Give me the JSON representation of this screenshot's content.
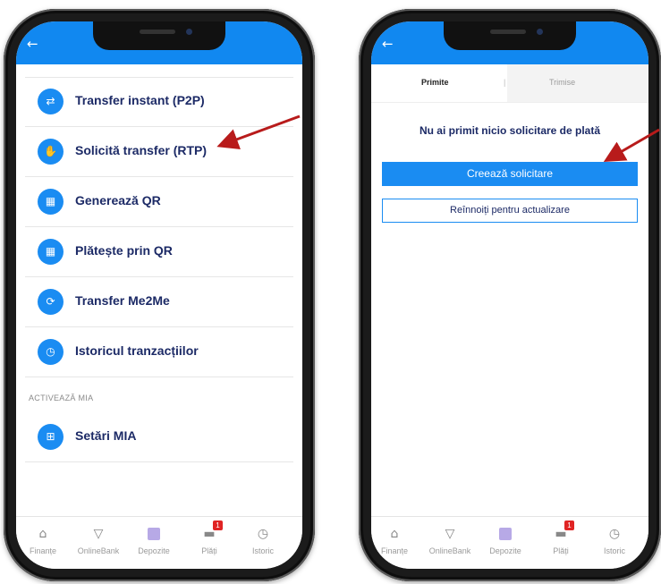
{
  "left_phone": {
    "menu_items": [
      {
        "label": "Transfer instant (P2P)",
        "icon": "transfer-instant-icon",
        "glyph": "⇄"
      },
      {
        "label": "Solicită transfer (RTP)",
        "icon": "request-transfer-icon",
        "glyph": "✋"
      },
      {
        "label": "Generează QR",
        "icon": "qr-generate-icon",
        "glyph": "▦"
      },
      {
        "label": "Plătește prin QR",
        "icon": "qr-pay-icon",
        "glyph": "▦"
      },
      {
        "label": "Transfer Me2Me",
        "icon": "me2me-icon",
        "glyph": "⟳"
      },
      {
        "label": "Istoricul tranzacțiilor",
        "icon": "history-icon",
        "glyph": "◷"
      }
    ],
    "section_label": "ACTIVEAZĂ MIA",
    "mia_item": {
      "label": "Setări MIA",
      "icon": "mia-settings-icon",
      "glyph": "⊞"
    }
  },
  "right_phone": {
    "tabs": {
      "active": "Primite",
      "separator": "|",
      "inactive": "Trimise"
    },
    "empty_message": "Nu ai primit nicio solicitare de plată",
    "create_button": "Creează solicitare",
    "refresh_button": "Reînnoiți pentru actualizare"
  },
  "bottom_nav": {
    "items": [
      {
        "label": "Finanțe",
        "icon": "home-icon"
      },
      {
        "label": "OnlineBank",
        "icon": "onlinebank-icon"
      },
      {
        "label": "Depozite",
        "icon": "deposits-icon"
      },
      {
        "label": "Plăți",
        "icon": "payments-icon",
        "badge": "1"
      },
      {
        "label": "Istoric",
        "icon": "clock-history-icon"
      }
    ]
  },
  "colors": {
    "accent": "#1188f0",
    "text_dark": "#1c2a66",
    "arrow": "#b81b1b",
    "badge": "#e02424"
  }
}
